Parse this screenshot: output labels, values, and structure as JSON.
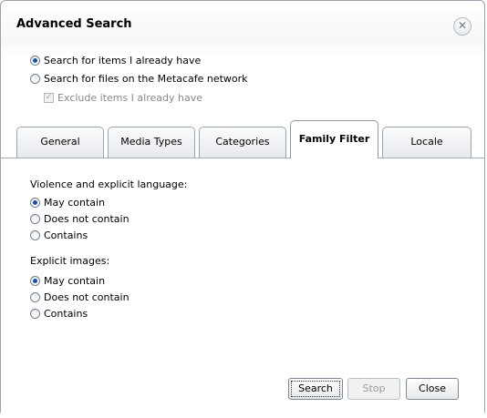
{
  "dialog": {
    "title": "Advanced Search",
    "close_glyph": "✕"
  },
  "scope": {
    "option_have": "Search for items I already have",
    "option_network": "Search for files on the Metacafe network",
    "exclude_label": "Exclude items I already have",
    "selected": "option_have",
    "exclude_checked": true,
    "exclude_disabled": true
  },
  "tabs": [
    {
      "label": "General",
      "active": false
    },
    {
      "label": "Media Types",
      "active": false
    },
    {
      "label": "Categories",
      "active": false
    },
    {
      "label": "Family Filter",
      "active": true
    },
    {
      "label": "Locale",
      "active": false
    }
  ],
  "family_filter": {
    "violence_heading": "Violence and explicit language:",
    "violence_options": [
      "May contain",
      "Does not contain",
      "Contains"
    ],
    "violence_selected": "May contain",
    "images_heading": "Explicit images:",
    "images_options": [
      "May contain",
      "Does not contain",
      "Contains"
    ],
    "images_selected": "May contain"
  },
  "buttons": {
    "search": "Search",
    "stop": "Stop",
    "close": "Close"
  }
}
